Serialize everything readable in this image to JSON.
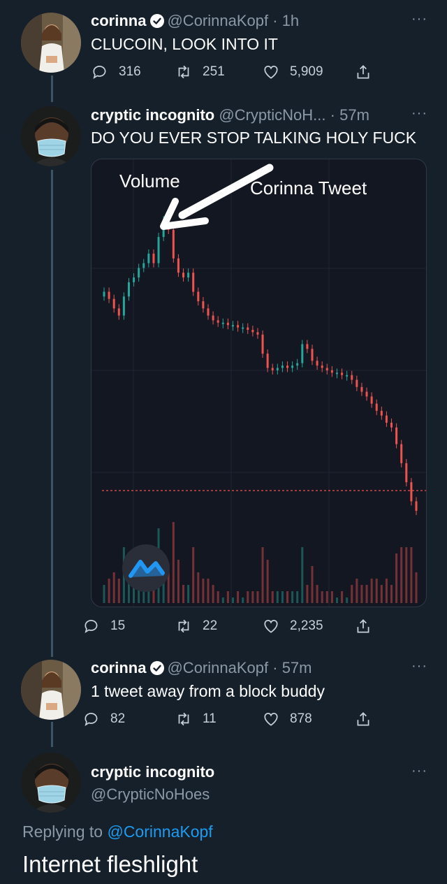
{
  "tweets": [
    {
      "name": "corinna",
      "handle": "@CorinnaKopf",
      "time": "1h",
      "text": "CLUCOIN, LOOK INTO IT",
      "replies": "316",
      "retweets": "251",
      "likes": "5,909",
      "verified": true
    },
    {
      "name": "cryptic incognito",
      "handle": "@CrypticNoH...",
      "time": "57m",
      "text": "DO YOU EVER STOP TALKING HOLY FUCK",
      "replies": "15",
      "retweets": "22",
      "likes": "2,235",
      "verified": false
    },
    {
      "name": "corinna",
      "handle": "@CorinnaKopf",
      "time": "57m",
      "text": "1 tweet away from a block buddy",
      "replies": "82",
      "retweets": "11",
      "likes": "878",
      "verified": true
    }
  ],
  "main_tweet": {
    "name": "cryptic incognito",
    "handle": "@CrypticNoHoes",
    "replying_label": "Replying to",
    "replying_to": "@CorinnaKopf",
    "text": "Internet fleshlight"
  },
  "more_glyph": "···",
  "time_separator": "·",
  "chart_annotation": {
    "volume_label": "Volume",
    "arrow_label": "Corinna Tweet"
  },
  "chart_data": {
    "type": "candlestick",
    "series": [
      {
        "close": [
          0.62,
          0.59,
          0.55,
          0.52,
          0.6,
          0.66,
          0.68,
          0.72,
          0.74,
          0.78,
          0.74,
          0.85,
          0.92,
          0.88,
          0.76,
          0.7,
          0.68,
          0.7,
          0.62,
          0.58,
          0.55,
          0.52,
          0.5,
          0.49,
          0.49,
          0.48,
          0.48,
          0.47,
          0.47,
          0.46,
          0.45,
          0.44,
          0.36,
          0.3,
          0.29,
          0.3,
          0.31,
          0.3,
          0.31,
          0.32,
          0.4,
          0.38,
          0.33,
          0.31,
          0.3,
          0.29,
          0.28,
          0.28,
          0.27,
          0.27,
          0.25,
          0.22,
          0.2,
          0.18,
          0.15,
          0.12,
          0.1,
          0.07,
          0.05,
          -0.02,
          -0.1,
          -0.18,
          -0.26,
          -0.3
        ]
      }
    ],
    "colors": {
      "up": "#26a69a",
      "down": "#ef5350"
    },
    "grid": true
  },
  "colors": {
    "background": "#15202b",
    "thread_line": "#3d5466",
    "handle": "#8b98a5",
    "verified": "#1d9bf0",
    "mention": "#1d9bf0",
    "chart_bg": "#131722",
    "marker_line": "#ef5350"
  },
  "icons": {
    "reply": "reply-icon",
    "retweet": "retweet-icon",
    "like": "heart-icon",
    "share": "share-icon",
    "verified": "verified-badge-icon",
    "more": "more-icon",
    "chart_logo": "tradingview-logo-icon"
  }
}
